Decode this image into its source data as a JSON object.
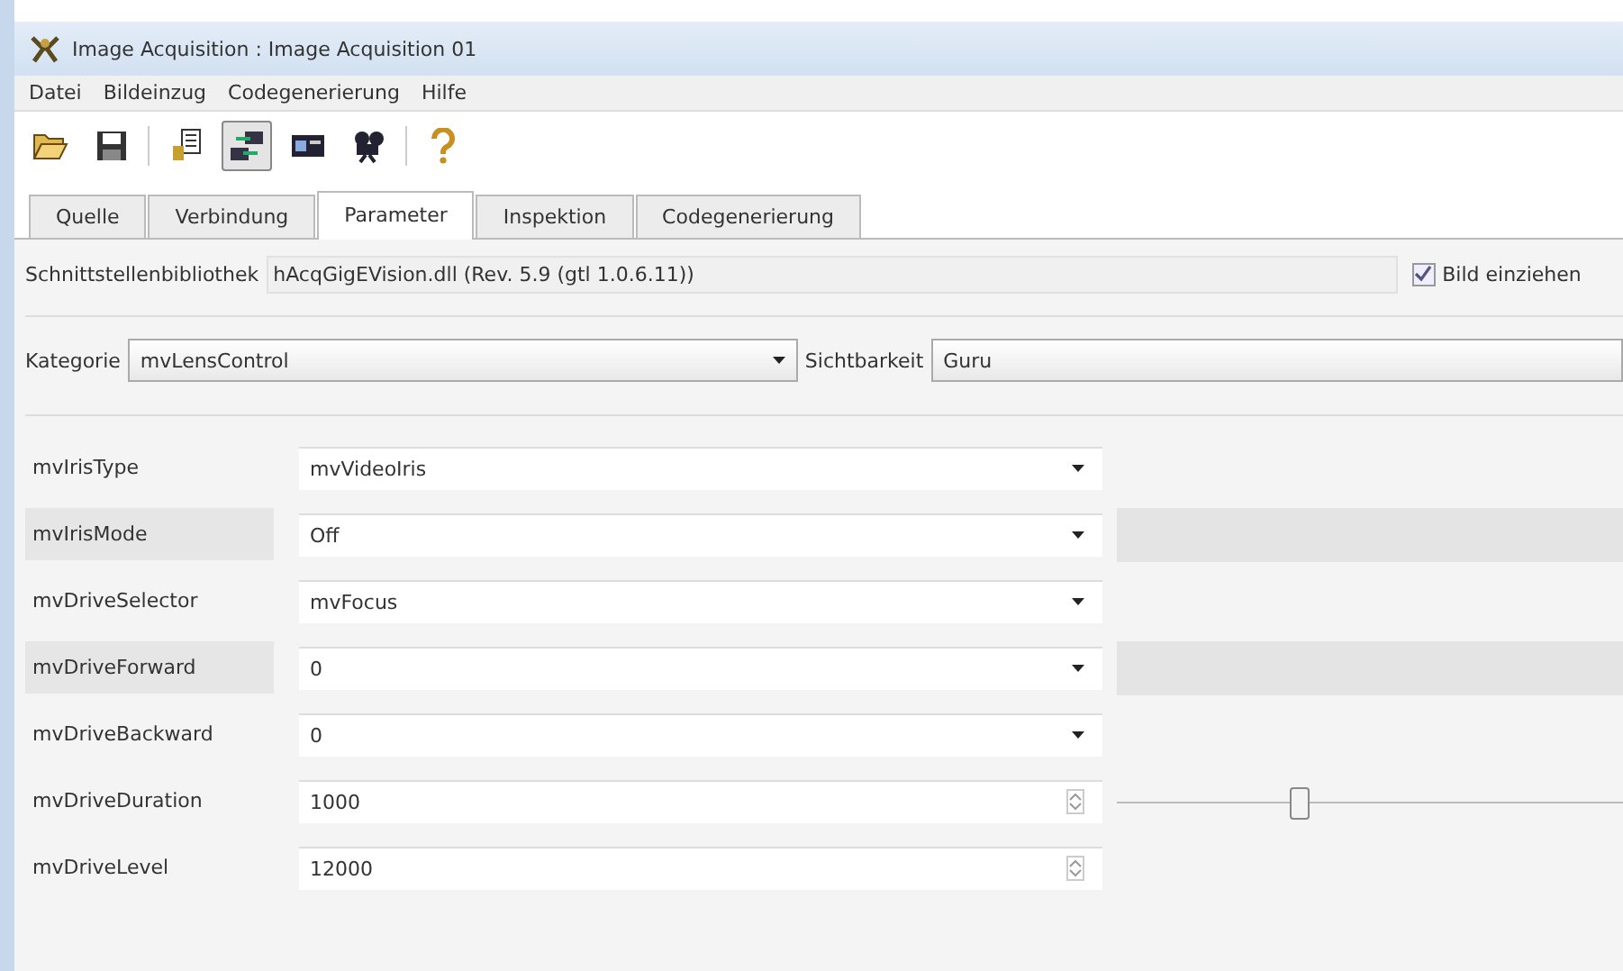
{
  "window": {
    "title": "Image Acquisition : Image Acquisition 01"
  },
  "menu": [
    "Datei",
    "Bildeinzug",
    "Codegenerierung",
    "Hilfe"
  ],
  "toolbar": [
    {
      "kind": "open",
      "pressed": false
    },
    {
      "kind": "save",
      "pressed": false
    },
    {
      "kind": "sep"
    },
    {
      "kind": "device",
      "pressed": false
    },
    {
      "kind": "connect",
      "pressed": true
    },
    {
      "kind": "card",
      "pressed": false
    },
    {
      "kind": "camera",
      "pressed": false
    },
    {
      "kind": "sep"
    },
    {
      "kind": "help",
      "pressed": false
    }
  ],
  "tabs": [
    {
      "label": "Quelle",
      "selected": false
    },
    {
      "label": "Verbindung",
      "selected": false
    },
    {
      "label": "Parameter",
      "selected": true
    },
    {
      "label": "Inspektion",
      "selected": false
    },
    {
      "label": "Codegenerierung",
      "selected": false
    }
  ],
  "library": {
    "label": "Schnittstellenbibliothek",
    "value": "hAcqGigEVision.dll (Rev. 5.9 (gtl 1.0.6.11))"
  },
  "grab_checkbox": {
    "label": "Bild einziehen",
    "checked": true
  },
  "category": {
    "label": "Kategorie",
    "value": "mvLensControl"
  },
  "visibility": {
    "label": "Sichtbarkeit",
    "value": "Guru"
  },
  "parameters": [
    {
      "name": "mvIrisType",
      "kind": "combo",
      "value": "mvVideoIris",
      "highlighted": false
    },
    {
      "name": "mvIrisMode",
      "kind": "combo",
      "value": "Off",
      "highlighted": true
    },
    {
      "name": "mvDriveSelector",
      "kind": "combo",
      "value": "mvFocus",
      "highlighted": false
    },
    {
      "name": "mvDriveForward",
      "kind": "combo",
      "value": "0",
      "highlighted": true
    },
    {
      "name": "mvDriveBackward",
      "kind": "combo",
      "value": "0",
      "highlighted": false
    },
    {
      "name": "mvDriveDuration",
      "kind": "spin",
      "value": "1000",
      "highlighted": false,
      "level": 0.34
    },
    {
      "name": "mvDriveLevel",
      "kind": "spin",
      "value": "12000",
      "highlighted": false
    }
  ]
}
